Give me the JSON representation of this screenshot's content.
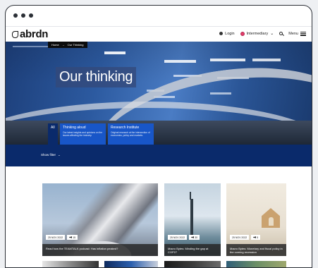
{
  "brand": {
    "logo_text": "abrdn"
  },
  "nav": {
    "login_label": "Login",
    "audience_label": "Intermediary",
    "menu_label": "Menu"
  },
  "breadcrumb": {
    "home": "Home",
    "separator": "→",
    "current": "Our Thinking"
  },
  "hero": {
    "title": "Our thinking"
  },
  "filters": {
    "all_label": "All",
    "cards": [
      {
        "title": "Thinking aloud",
        "description": "Our latest insights and opinions on the issues affecting the industry."
      },
      {
        "title": "Research Institute",
        "description": "Original research at the intersection of economics, policy and markets."
      }
    ]
  },
  "filterbar": {
    "show_filter_label": "Show filter"
  },
  "articles": [
    {
      "date": "25 NOV 2022",
      "listen": "15",
      "caption": "Read how the TEAMTALK podcast: Has inflation peaked?"
    },
    {
      "date": "25 NOV 2022",
      "listen": "30",
      "caption": "Macro Bytes: Minding the gap at COP27"
    },
    {
      "date": "25 NOV 2022",
      "listen": "5",
      "caption": "Macro Bytes: Monetary and fiscal policy in the coming recession"
    }
  ],
  "colors": {
    "navy": "#0a2a6b",
    "blue": "#1856c8",
    "brand_pink": "#e33b6a"
  }
}
